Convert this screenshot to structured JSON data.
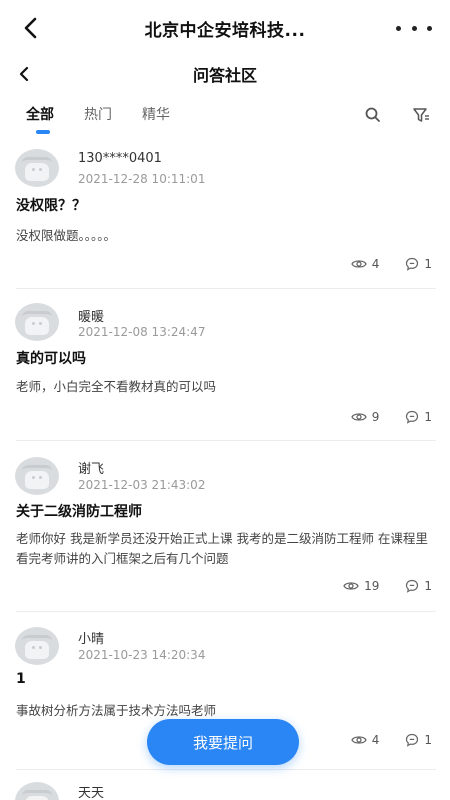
{
  "app": {
    "title": "北京中企安培科技..."
  },
  "page": {
    "title": "问答社区"
  },
  "tabs": [
    {
      "label": "全部",
      "active": true
    },
    {
      "label": "热门",
      "active": false
    },
    {
      "label": "精华",
      "active": false
    }
  ],
  "icons": {
    "search": "search-icon",
    "filter": "filter-icon",
    "back": "chevron-left-icon",
    "more": "more-dots-icon",
    "views": "eye-icon",
    "comments": "comment-icon"
  },
  "accent": "#2a86f5",
  "posts": [
    {
      "user": "130****0401",
      "date": "2021-12-28 10:11:01",
      "title": "没权限？？",
      "body": "没权限做题。。。。。",
      "views": "4",
      "comments": "1"
    },
    {
      "user": "暖暖",
      "date": "2021-12-08 13:24:47",
      "title": "真的可以吗",
      "body": "老师，小白完全不看教材真的可以吗",
      "views": "9",
      "comments": "1"
    },
    {
      "user": "谢飞",
      "date": "2021-12-03 21:43:02",
      "title": "关于二级消防工程师",
      "body": "老师你好 我是新学员还没开始正式上课 我考的是二级消防工程师 在课程里看完考师讲的入门框架之后有几个问题",
      "views": "19",
      "comments": "1"
    },
    {
      "user": "小晴",
      "date": "2021-10-23 14:20:34",
      "title": "1",
      "body": "事故树分析方法属于技术方法吗老师",
      "views": "4",
      "comments": "1"
    },
    {
      "user": "天天"
    }
  ],
  "fab": {
    "label": "我要提问"
  }
}
